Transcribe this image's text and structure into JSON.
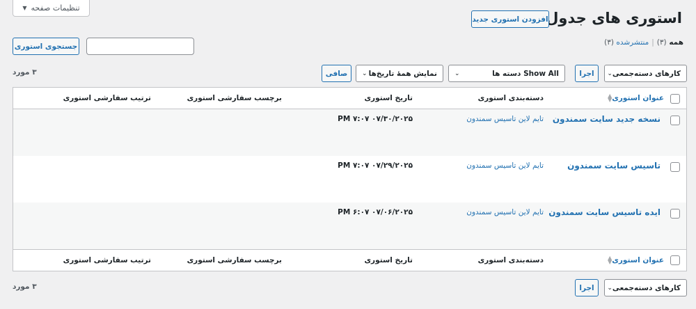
{
  "screen_options": {
    "label": "تنظیمات صفحه"
  },
  "page": {
    "title": "استوری های جدول زمانی",
    "add_new": "افزودن استوری جدید"
  },
  "views": {
    "all_label": "همه",
    "all_count": "(۳)",
    "sep": "|",
    "published_label": "منتشرشده",
    "published_count": "(۳)"
  },
  "search": {
    "button": "جستجوی استوری",
    "value": ""
  },
  "top_nav": {
    "bulk_select": "کارهای دسته‌جمعی",
    "apply": "اجرا",
    "category_select": "Show All دسته ها",
    "date_select": "نمایش همهٔ تاریخ‌ها",
    "filter": "صافی",
    "count": "۳ مورد"
  },
  "bottom_nav": {
    "bulk_select": "کارهای دسته‌جمعی",
    "apply": "اجرا",
    "count": "۳ مورد"
  },
  "columns": {
    "title": "عنوان استوری",
    "category": "دسته‌بندی استوری",
    "date": "تاریخ استوری",
    "tag": "برچسب سفارشی استوری",
    "order": "ترتیب سفارشی استوری"
  },
  "rows": [
    {
      "title": "نسخه جدید سایت سمندون",
      "category": "تایم لاین تاسیس سمندون",
      "date": "PM ۷:۰۷ ۰۷/۳۰/۲۰۲۵"
    },
    {
      "title": "تاسیس سایت سمندون",
      "category": "تایم لاین تاسیس سمندون",
      "date": "PM ۷:۰۷ ۰۷/۲۹/۲۰۲۵"
    },
    {
      "title": "ایده تاسیس سایت سمندون",
      "category": "تایم لاین تاسیس سمندون",
      "date": "PM ۶:۰۷ ۰۷/۰۶/۲۰۲۵"
    }
  ]
}
